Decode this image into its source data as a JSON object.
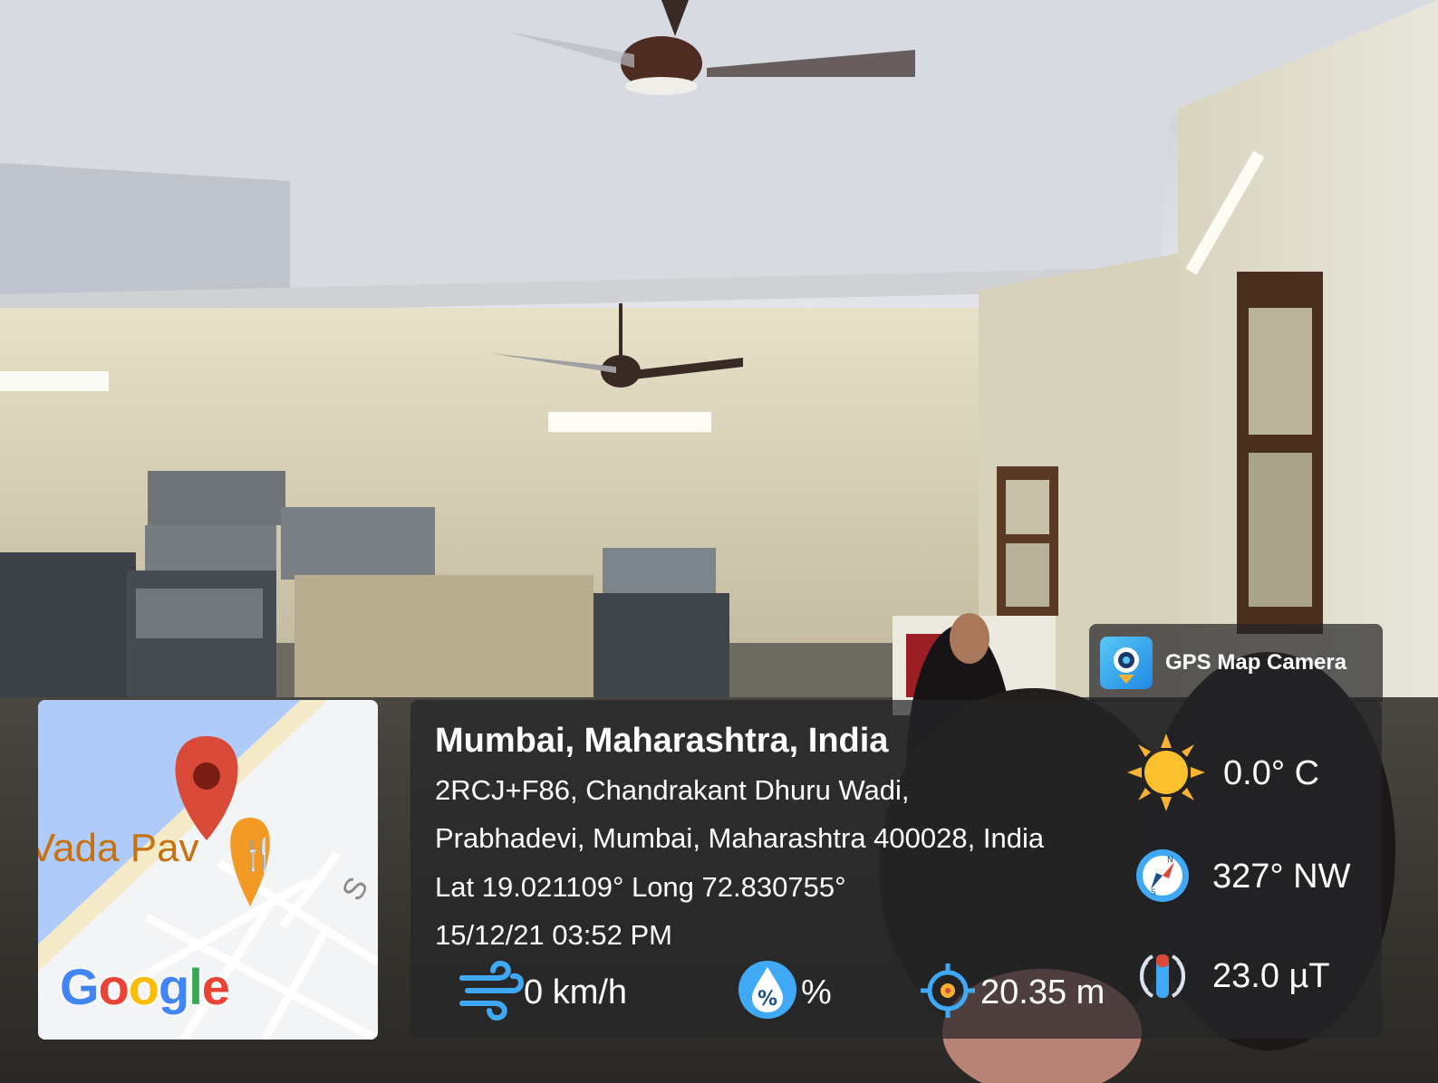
{
  "map": {
    "place_label": "Vada Pav",
    "road_label": "S",
    "logo_letters": [
      "G",
      "o",
      "o",
      "g",
      "l",
      "e"
    ],
    "logo_colors": [
      "#4285F4",
      "#EA4335",
      "#FBBC05",
      "#4285F4",
      "#34A853",
      "#EA4335"
    ],
    "pin_color": "#D94A38",
    "food_pin_color": "#F29A24",
    "water_color": "#AECBFA",
    "sand_color": "#F4EAC8"
  },
  "brand": {
    "app_name": "GPS Map Camera",
    "icon": "gps-map-camera-logo"
  },
  "location": {
    "city": "Mumbai, Maharashtra, India",
    "address_line1": "2RCJ+F86, Chandrakant Dhuru Wadi,",
    "address_line2": "Prabhadevi, Mumbai, Maharashtra 400028, India",
    "coordinates": "Lat 19.021109° Long 72.830755°",
    "datetime": "15/12/21 03:52 PM"
  },
  "stats": {
    "wind": "0 km/h",
    "humidity": "%",
    "altitude": "20.35 m",
    "temperature": "0.0° C",
    "direction": "327° NW",
    "magnetic_field": "23.0 µT"
  },
  "icons": {
    "wind": "wind-icon",
    "humidity": "humidity-icon",
    "altitude": "altitude-target-icon",
    "temperature": "sun-icon",
    "direction": "compass-icon",
    "magnetic_field": "magnet-icon"
  },
  "colors": {
    "panel": "#262628",
    "accent_blue": "#3FA9F5",
    "sun": "#F9B233"
  }
}
